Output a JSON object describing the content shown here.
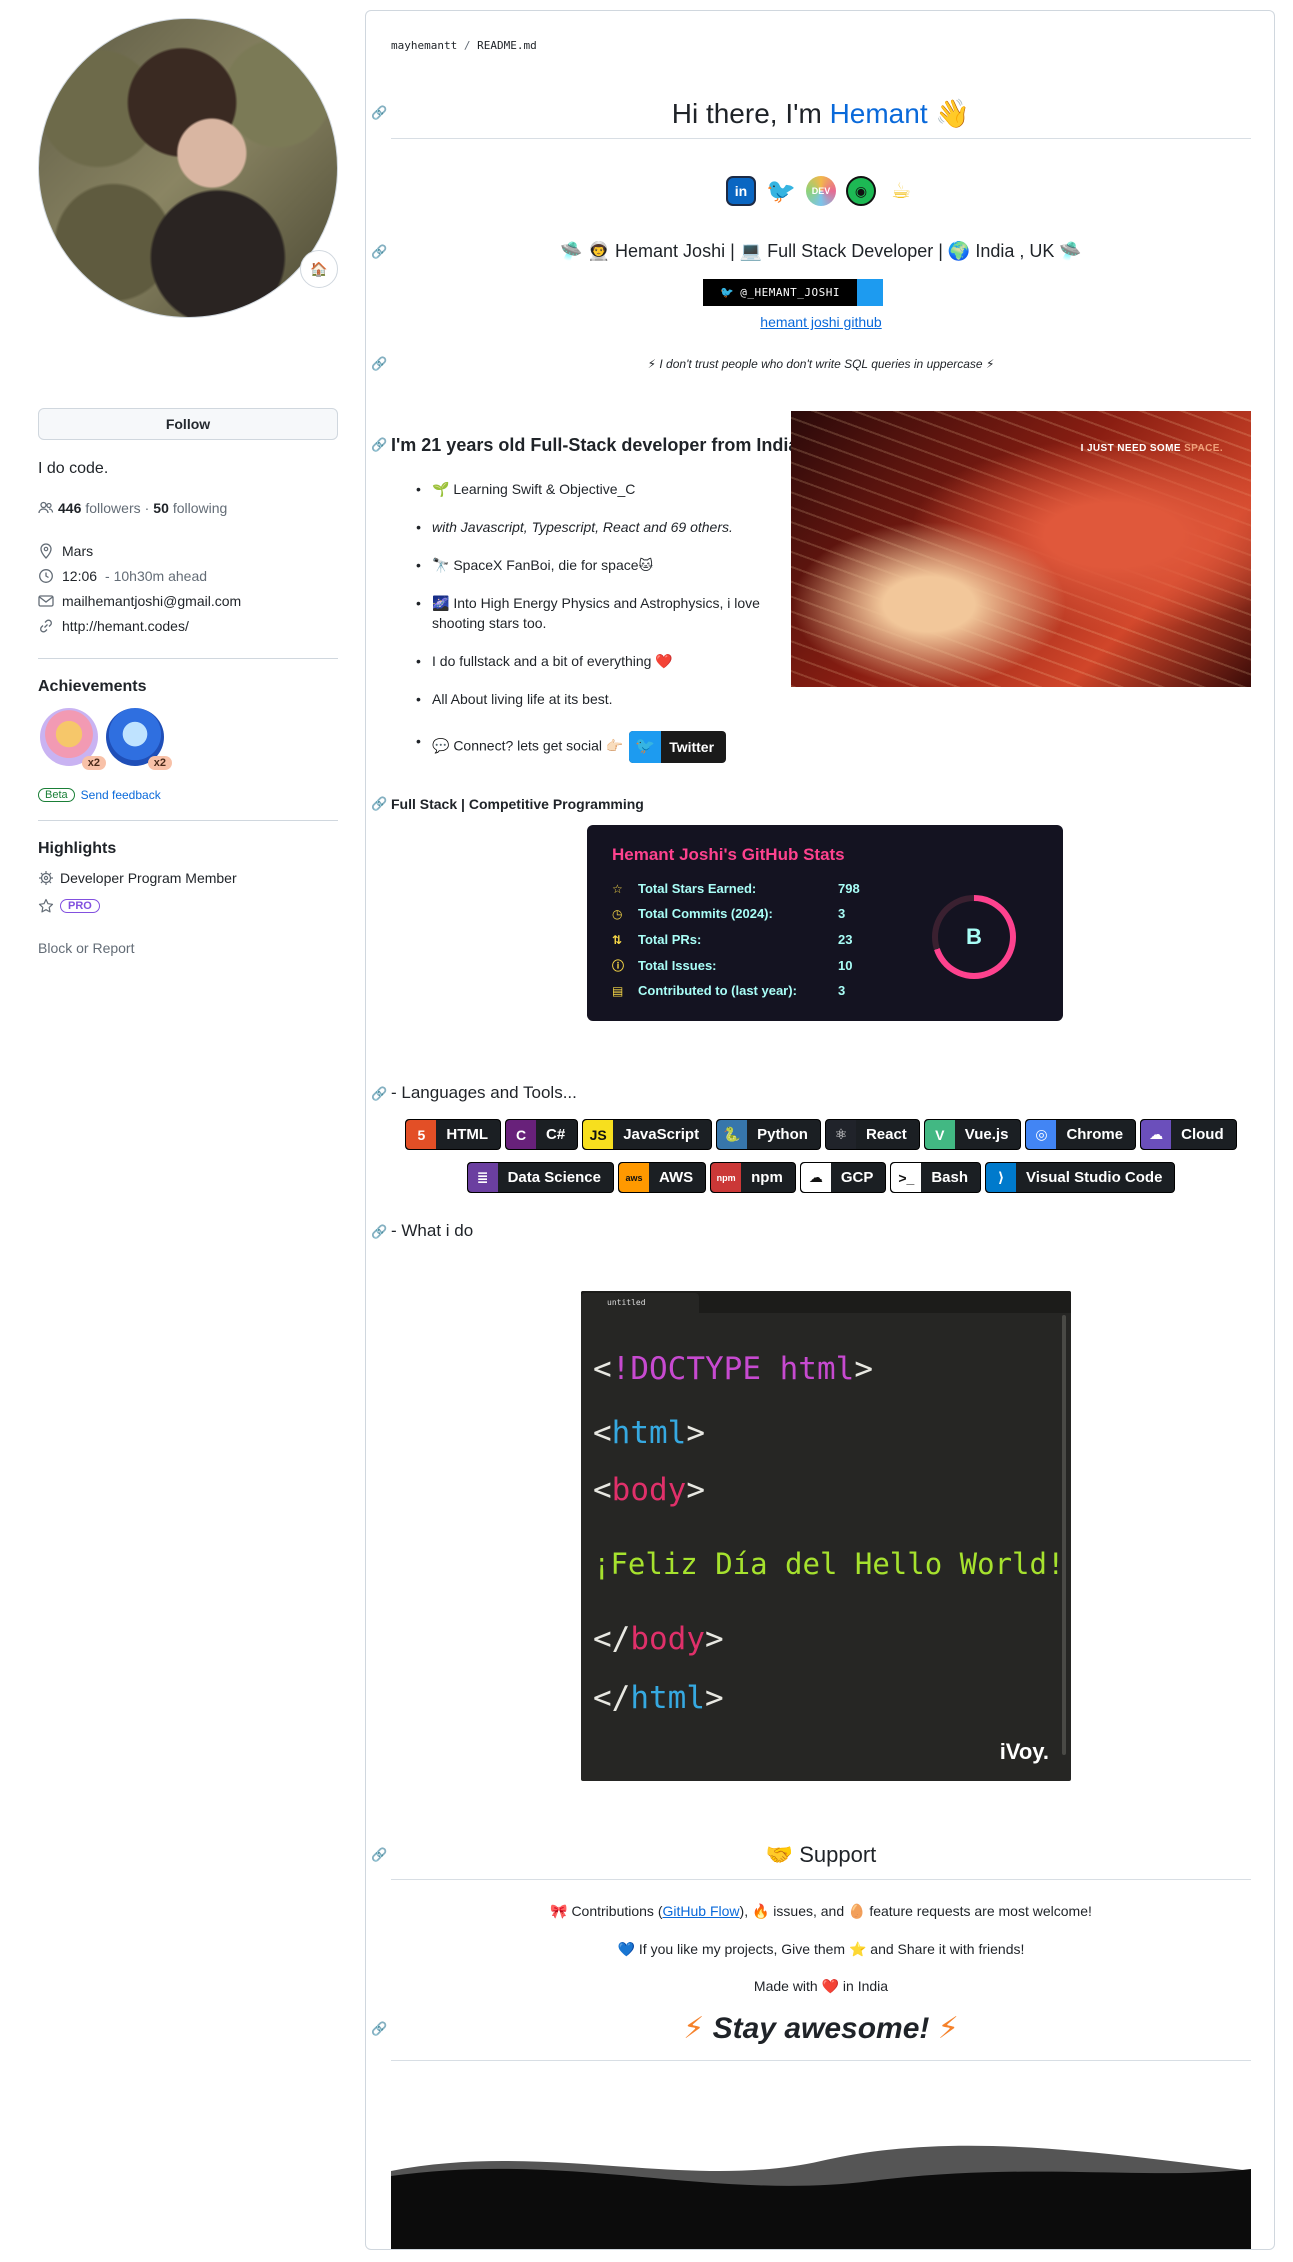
{
  "profile": {
    "status_emoji": "🏠",
    "follow_label": "Follow",
    "bio": "I do code.",
    "followers_count": "446",
    "followers_label": "followers",
    "following_count": "50",
    "following_label": "following",
    "location": "Mars",
    "time": "12:06",
    "time_ahead": "- 10h30m ahead",
    "email": "mailhemantjoshi@gmail.com",
    "website": "http://hemant.codes/",
    "achievements_heading": "Achievements",
    "achievement_multiplier_1": "x2",
    "achievement_multiplier_2": "x2",
    "beta_label": "Beta",
    "feedback_label": "Send feedback",
    "highlights_heading": "Highlights",
    "highlight_dev": "Developer Program Member",
    "pro_label": "PRO",
    "block_label": "Block or Report"
  },
  "readme": {
    "crumb_user": "mayhemantt",
    "crumb_sep": "/",
    "crumb_file": "README.md",
    "greeting_prefix": "Hi there, I'm ",
    "greeting_name": "Hemant",
    "greeting_emoji": "👋",
    "social_icons": [
      "in",
      "🐦",
      "DEV",
      "◉",
      "☕"
    ],
    "tagline": "🛸 👨‍🚀 Hemant Joshi | 💻 Full Stack Developer | 🌍 India , UK 🛸",
    "twitter_badge": "@_HEMANT_JOSHI",
    "gh_link": "hemant joshi github",
    "quote": "⚡ I don't trust people who don't write SQL queries in uppercase ⚡",
    "about_heading": "I'm 21 years old Full-Stack developer from India.",
    "gif_caption_main": "I JUST NEED SOME ",
    "gif_caption_dim": "SPACE.",
    "bullets": [
      "🌱 Learning Swift & Objective_C",
      "with Javascript, Typescript, React and 69 others.",
      "🔭 SpaceX FanBoi, die for space🐱",
      "🌌 Into High Energy Physics and Astrophysics, i love shooting stars too.",
      "I do fullstack and a bit of everything ❤️",
      "All About living life at its best.",
      "💬 Connect? lets get social 👉🏻"
    ],
    "twitter_btn": "Twitter",
    "fullstack_heading": "Full Stack | Competitive Programming",
    "stats": {
      "title": "Hemant Joshi's GitHub Stats",
      "rows": [
        {
          "icon": "☆",
          "label": "Total Stars Earned:",
          "value": "798"
        },
        {
          "icon": "◷",
          "label": "Total Commits (2024):",
          "value": "3"
        },
        {
          "icon": "⇅",
          "label": "Total PRs:",
          "value": "23"
        },
        {
          "icon": "ⓘ",
          "label": "Total Issues:",
          "value": "10"
        },
        {
          "icon": "▤",
          "label": "Contributed to (last year):",
          "value": "3"
        }
      ],
      "grade": "B",
      "grade_progress_pct": 70
    },
    "languages_heading": "- Languages and Tools...",
    "tools": [
      {
        "name": "HTML",
        "glyph": "5",
        "color": "#e34f26"
      },
      {
        "name": "C#",
        "glyph": "C",
        "color": "#68217a"
      },
      {
        "name": "JavaScript",
        "glyph": "JS",
        "color": "#f7df1e"
      },
      {
        "name": "Python",
        "glyph": "🐍",
        "color": "#3776ab"
      },
      {
        "name": "React",
        "glyph": "⚛",
        "color": "#20232a"
      },
      {
        "name": "Vue.js",
        "glyph": "V",
        "color": "#42b883"
      },
      {
        "name": "Chrome",
        "glyph": "◎",
        "color": "#4285f4"
      },
      {
        "name": "Cloud",
        "glyph": "☁",
        "color": "#6b4fbb"
      },
      {
        "name": "Data Science",
        "glyph": "≣",
        "color": "#6b3fa0"
      },
      {
        "name": "AWS",
        "glyph": "aws",
        "color": "#ff9900"
      },
      {
        "name": "npm",
        "glyph": "npm",
        "color": "#cb3837"
      },
      {
        "name": "GCP",
        "glyph": "☁",
        "color": "#ffffff"
      },
      {
        "name": "Bash",
        "glyph": ">_",
        "color": "#ffffff"
      },
      {
        "name": "Visual Studio Code",
        "glyph": "⟩",
        "color": "#007acc"
      }
    ],
    "whatido_heading": "- What i do",
    "code_tab": "untitled",
    "code_lines": {
      "l1_open": "<",
      "l1_tag": "!DOCTYPE html",
      "l1_close": ">",
      "l2_open": "<",
      "l2_tag": "html",
      "l2_close": ">",
      "l3_open": "<",
      "l3_tag": "body",
      "l3_close": ">",
      "l4_text": "¡Feliz Día del Hello World!",
      "l5_open": "</",
      "l5_tag": "body",
      "l5_close": ">",
      "l6_open": "</",
      "l6_tag": "html",
      "l6_close": ">"
    },
    "code_logo": "iVoy.",
    "support_heading": "🤝 Support",
    "support_p1_pre": "🎀 Contributions (",
    "support_p1_link": "GitHub Flow",
    "support_p1_post": "), 🔥 issues, and 🥚 feature requests are most welcome!",
    "support_p2": "💙 If you like my projects, Give them ⭐ and Share it with friends!",
    "support_p3": "Made with ❤️ in India",
    "stay_bolt_left": "⚡",
    "stay_text": "Stay awesome!",
    "stay_bolt_right": "⚡"
  }
}
